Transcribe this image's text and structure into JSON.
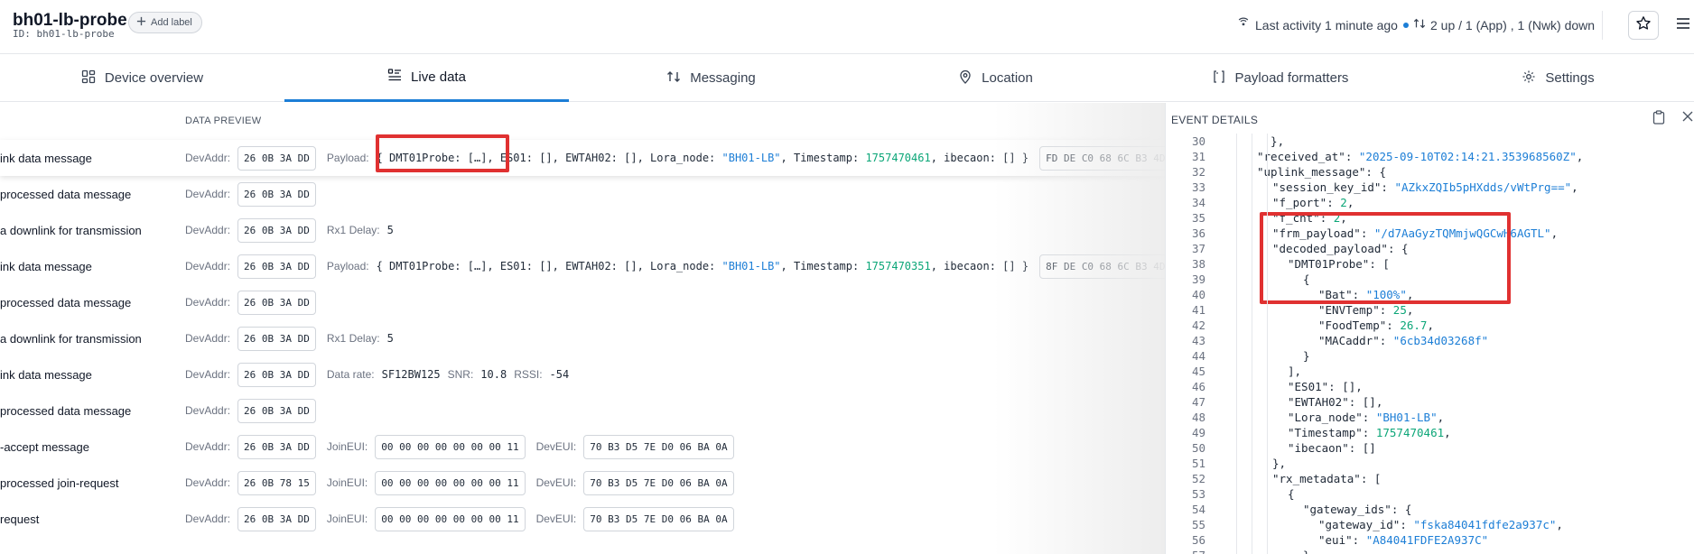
{
  "header": {
    "title": "bh01-lb-probe",
    "id_text": "ID: bh01-lb-probe",
    "add_label": "Add label",
    "activity": "Last activity 1 minute ago",
    "updown": "2 up / 1 (App) , 1 (Nwk) down"
  },
  "tabs": [
    {
      "label": "Device overview",
      "icon": "grid-icon"
    },
    {
      "label": "Live data",
      "icon": "list-icon"
    },
    {
      "label": "Messaging",
      "icon": "arrows-updown-icon"
    },
    {
      "label": "Location",
      "icon": "location-pin-icon"
    },
    {
      "label": "Payload formatters",
      "icon": "code-brackets-icon"
    },
    {
      "label": "Settings",
      "icon": "gear-icon"
    }
  ],
  "live": {
    "column_header": "DATA PREVIEW",
    "labels": {
      "devaddr": "DevAddr:",
      "payload": "Payload:",
      "rx1": "Rx1 Delay:",
      "datarate": "Data rate:",
      "snr": "SNR:",
      "rssi": "RSSI:",
      "joineui": "JoinEUI:",
      "deveui": "DevEUI:"
    },
    "rows": [
      {
        "event": "ink data message",
        "devaddr": "26 0B 3A DD",
        "payload_open": "{ DMT01Probe: […], ES01: [], EWTAH02: [], Lora_node: ",
        "lora": "\"BH01-LB\"",
        "mid": ", Timestamp: ",
        "ts": "1757470461",
        "payload_close": ", ibecaon: [] }",
        "raw": "FD DE C0 68 6C B3 4D"
      },
      {
        "event": "processed data message",
        "devaddr": "26 0B 3A DD"
      },
      {
        "event": "a downlink for transmission",
        "devaddr": "26 0B 3A DD",
        "rx1": "5"
      },
      {
        "event": "ink data message",
        "devaddr": "26 0B 3A DD",
        "payload_open": "{ DMT01Probe: […], ES01: [], EWTAH02: [], Lora_node: ",
        "lora": "\"BH01-LB\"",
        "mid": ", Timestamp: ",
        "ts": "1757470351",
        "payload_close": ", ibecaon: [] }",
        "raw": "8F DE C0 68 6C B3 4D"
      },
      {
        "event": "processed data message",
        "devaddr": "26 0B 3A DD"
      },
      {
        "event": "a downlink for transmission",
        "devaddr": "26 0B 3A DD",
        "rx1": "5"
      },
      {
        "event": "ink data message",
        "devaddr": "26 0B 3A DD",
        "datarate": "SF12BW125",
        "snr": "10.8",
        "rssi": "-54"
      },
      {
        "event": "processed data message",
        "devaddr": "26 0B 3A DD"
      },
      {
        "event": "-accept message",
        "devaddr": "26 0B 3A DD",
        "joineui": "00 00 00 00 00 00 00 11",
        "deveui": "70 B3 D5 7E D0 06 BA 0A"
      },
      {
        "event": "processed join-request",
        "devaddr": "26 0B 78 15",
        "joineui": "00 00 00 00 00 00 00 11",
        "deveui": "70 B3 D5 7E D0 06 BA 0A"
      },
      {
        "event": "request",
        "devaddr": "26 0B 3A DD",
        "joineui": "00 00 00 00 00 00 00 11",
        "deveui": "70 B3 D5 7E D0 06 BA 0A"
      }
    ]
  },
  "details": {
    "title": "EVENT DETAILS",
    "lines": [
      {
        "n": "30",
        "html": "  },"
      },
      {
        "n": "31",
        "k": "\"received_at\"",
        "v": "\"2025-09-10T02:14:21.353968560Z\"",
        "t": "s",
        "i": 1,
        "e": ","
      },
      {
        "n": "32",
        "k": "\"uplink_message\"",
        "raw": ": {",
        "i": 1
      },
      {
        "n": "33",
        "k": "\"session_key_id\"",
        "v": "\"AZkxZQIb5pHXdds/vWtPrg==\"",
        "t": "s",
        "i": 2,
        "e": ","
      },
      {
        "n": "34",
        "k": "\"f_port\"",
        "v": "2",
        "t": "n",
        "i": 2,
        "e": ","
      },
      {
        "n": "35",
        "k": "\"f_cnt\"",
        "v": "2",
        "t": "n",
        "i": 2,
        "e": ","
      },
      {
        "n": "36",
        "k": "\"frm_payload\"",
        "v": "\"/d7AaGyzTQMmjwQGCwH6AGTL\"",
        "t": "s",
        "i": 2,
        "e": ","
      },
      {
        "n": "37",
        "k": "\"decoded_payload\"",
        "raw": ": {",
        "i": 2
      },
      {
        "n": "38",
        "k": "\"DMT01Probe\"",
        "raw": ": [",
        "i": 3
      },
      {
        "n": "39",
        "raw": "{",
        "i": 4
      },
      {
        "n": "40",
        "k": "\"Bat\"",
        "v": "\"100%\"",
        "t": "s",
        "i": 5,
        "e": ","
      },
      {
        "n": "41",
        "k": "\"ENVTemp\"",
        "v": "25",
        "t": "n",
        "i": 5,
        "e": ","
      },
      {
        "n": "42",
        "k": "\"FoodTemp\"",
        "v": "26.7",
        "t": "n",
        "i": 5,
        "e": ","
      },
      {
        "n": "43",
        "k": "\"MACaddr\"",
        "v": "\"6cb34d03268f\"",
        "t": "s",
        "i": 5,
        "e": ""
      },
      {
        "n": "44",
        "raw": "}",
        "i": 4
      },
      {
        "n": "45",
        "raw": "],",
        "i": 3
      },
      {
        "n": "46",
        "k": "\"ES01\"",
        "raw": ": [],",
        "i": 3
      },
      {
        "n": "47",
        "k": "\"EWTAH02\"",
        "raw": ": [],",
        "i": 3
      },
      {
        "n": "48",
        "k": "\"Lora_node\"",
        "v": "\"BH01-LB\"",
        "t": "s",
        "i": 3,
        "e": ","
      },
      {
        "n": "49",
        "k": "\"Timestamp\"",
        "v": "1757470461",
        "t": "n",
        "i": 3,
        "e": ","
      },
      {
        "n": "50",
        "k": "\"ibecaon\"",
        "raw": ": []",
        "i": 3
      },
      {
        "n": "51",
        "raw": "},",
        "i": 2
      },
      {
        "n": "52",
        "k": "\"rx_metadata\"",
        "raw": ": [",
        "i": 2
      },
      {
        "n": "53",
        "raw": "{",
        "i": 3
      },
      {
        "n": "54",
        "k": "\"gateway_ids\"",
        "raw": ": {",
        "i": 4
      },
      {
        "n": "55",
        "k": "\"gateway_id\"",
        "v": "\"fska84041fdfe2a937c\"",
        "t": "s",
        "i": 5,
        "e": ","
      },
      {
        "n": "56",
        "k": "\"eui\"",
        "v": "\"A84041FDFE2A937C\"",
        "t": "s",
        "i": 5,
        "e": ""
      },
      {
        "n": "57",
        "raw": "},",
        "i": 4
      }
    ]
  },
  "colors": {
    "accent": "#1c7ed6",
    "highlight": "#e03131",
    "number": "#0ca678"
  }
}
